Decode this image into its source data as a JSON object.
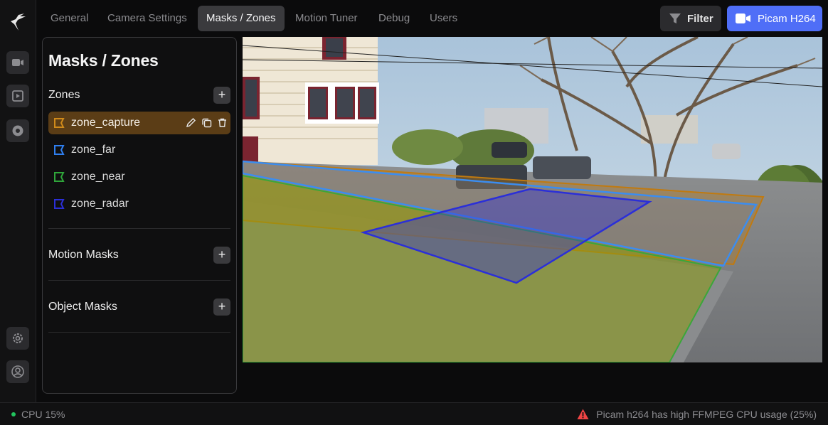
{
  "nav": {
    "tabs": [
      {
        "label": "General",
        "active": false
      },
      {
        "label": "Camera Settings",
        "active": false
      },
      {
        "label": "Masks / Zones",
        "active": true
      },
      {
        "label": "Motion Tuner",
        "active": false
      },
      {
        "label": "Debug",
        "active": false
      },
      {
        "label": "Users",
        "active": false
      }
    ],
    "filter_label": "Filter",
    "camera_label": "Picam H264"
  },
  "rail": {
    "icons": [
      "logo-icon",
      "video-camera-icon",
      "recordings-icon",
      "explore-icon",
      "settings-gear-icon",
      "account-icon"
    ]
  },
  "panel": {
    "title": "Masks / Zones",
    "zones_heading": "Zones",
    "zones": [
      {
        "name": "zone_capture",
        "color": "#d08a1a",
        "selected": true
      },
      {
        "name": "zone_far",
        "color": "#2f7ff0",
        "selected": false
      },
      {
        "name": "zone_near",
        "color": "#2fa53a",
        "selected": false
      },
      {
        "name": "zone_radar",
        "color": "#2b2fd8",
        "selected": false
      }
    ],
    "motion_masks_heading": "Motion Masks",
    "object_masks_heading": "Object Masks",
    "add_symbol": "+"
  },
  "colors": {
    "accent": "#4f6ef7",
    "selected_zone_bg": "#5b3d16",
    "status_ok": "#22c55e",
    "warning": "#ef4444"
  },
  "status": {
    "cpu": "CPU 15%",
    "warning": "Picam h264 has high FFMPEG CPU usage (25%)"
  }
}
